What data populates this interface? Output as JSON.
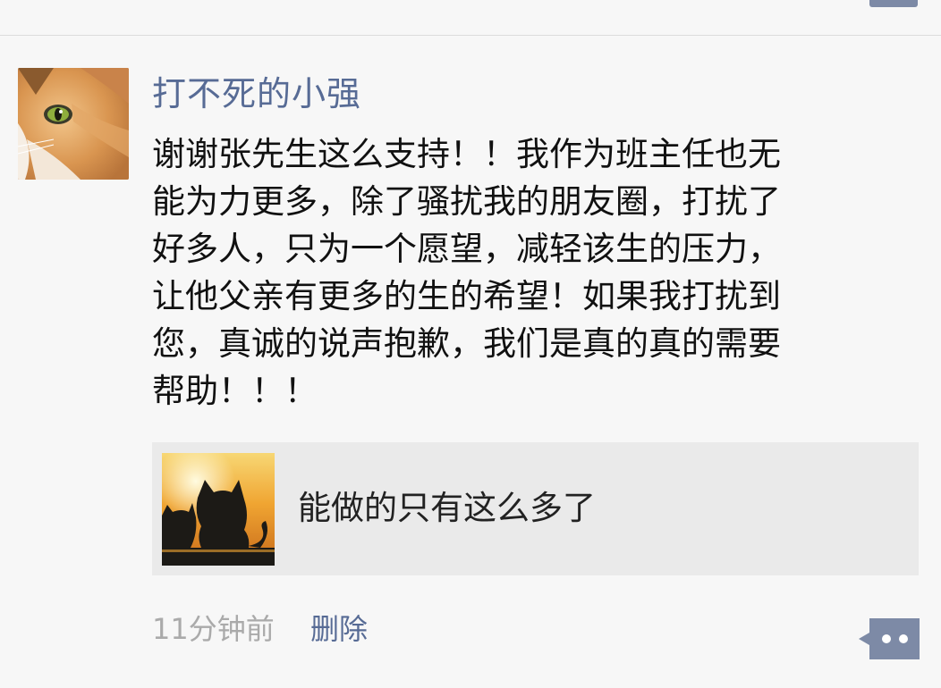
{
  "post": {
    "author": "打不死的小强",
    "text_lines": [
      "谢谢张先生这么支持！！我作为班主任也无",
      "能为力更多，除了骚扰我的朋友圈，打扰了",
      "好多人，只为一个愿望，减轻该生的压力，",
      "让他父亲有更多的生的希望！如果我打扰到",
      "您，真诚的说声抱歉，我们是真的真的需要",
      "帮助！！！"
    ],
    "shared": {
      "title": "能做的只有这么多了"
    },
    "time": "11分钟前",
    "delete_label": "删除"
  },
  "colors": {
    "link": "#576b95",
    "background": "#f7f7f7",
    "share_card": "#eaeaea",
    "timestamp": "#aaaaaa",
    "action_button": "#7d8aa6"
  },
  "icons": {
    "avatar": "cat-avatar",
    "share_thumbnail": "cats-sunset-thumbnail",
    "action": "more-dots-icon"
  }
}
